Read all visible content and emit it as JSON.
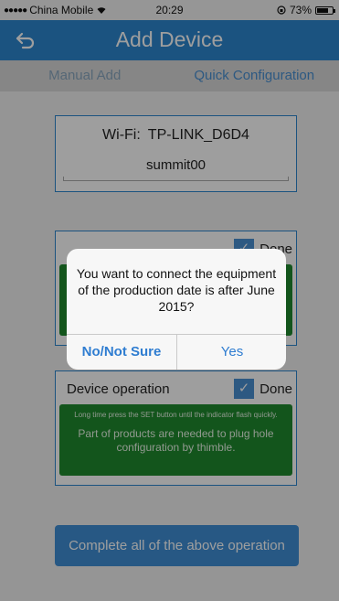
{
  "status_bar": {
    "carrier": "China Mobile",
    "time": "20:29",
    "battery": "73%",
    "battery_level": 0.73
  },
  "nav": {
    "title": "Add Device",
    "back_icon": "back-arrow-icon"
  },
  "tabs": [
    {
      "label": "Manual Add",
      "active": false
    },
    {
      "label": "Quick Configuration",
      "active": true
    }
  ],
  "wifi": {
    "label": "Wi-Fi:",
    "ssid": "TP-LINK_D6D4",
    "password": "summit00"
  },
  "step1": {
    "done_label": "Done",
    "checked": true
  },
  "step2": {
    "title": "Device operation",
    "done_label": "Done",
    "checked": true,
    "hint_small": "Long time press the SET button until the indicator flash quickly.",
    "hint_main": "Part of products are needed to plug hole configuration by thimble."
  },
  "complete_button": "Complete all of the above operation",
  "alert": {
    "message": "You want to connect the equipment of the production date is after June 2015?",
    "buttons": [
      "No/Not Sure",
      "Yes"
    ]
  },
  "colors": {
    "nav": "#2d86cf",
    "accent": "#4a90d2",
    "hint_bg": "#1f8a2e"
  }
}
